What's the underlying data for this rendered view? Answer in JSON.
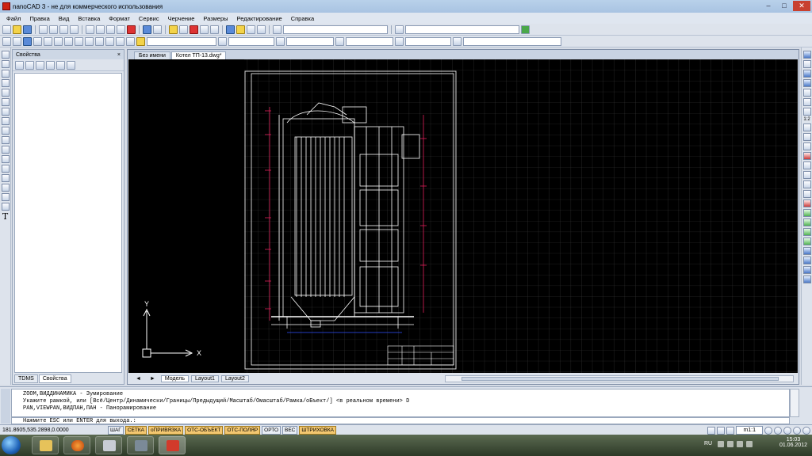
{
  "window": {
    "title": "nanoCAD 3 - не для коммерческого использования"
  },
  "menu": [
    "Файл",
    "Правка",
    "Вид",
    "Вставка",
    "Формат",
    "Сервис",
    "Черчение",
    "Размеры",
    "Редактирование",
    "Справка"
  ],
  "properties_panel": {
    "title": "Свойства",
    "close_glyph": "×",
    "tabs": [
      "TDMS",
      "Свойства"
    ]
  },
  "document_tabs": [
    "Без имени",
    "Котел ТП-13.dwg*"
  ],
  "layout_tabs": [
    "Модель",
    "Layout1",
    "Layout2"
  ],
  "layout_nav": [
    "◄",
    "►"
  ],
  "ucs": {
    "y_label": "Y",
    "x_label": "X"
  },
  "left_tools": {
    "text_tool_glyph": "T"
  },
  "right_tools": {
    "scale_label": "1:2"
  },
  "command": {
    "history": [
      "ZOOM,ВИДДИНАМИКА - Зумирование",
      "Укажите рамкой, или [Всё/Центр/Динамически/Границы/Предыдущий/Масштаб/Омасштаб/Рамка/оБъект/] <в реальном времени> D",
      "PAN,VIEWPAN,ВИДПАН,ПАН - Панорамирование"
    ],
    "prompt": "Нажмите  ESC или ENTER для выхода.:"
  },
  "status": {
    "coords": "181.8605,535.2898,0.0000",
    "buttons": [
      {
        "label": "ШАГ",
        "on": false
      },
      {
        "label": "СЕТКА",
        "on": true
      },
      {
        "label": "оПРИВЯЗКА",
        "on": true
      },
      {
        "label": "ОТС-ОБЪЕКТ",
        "on": true
      },
      {
        "label": "ОТС-ПОЛЯР",
        "on": true
      },
      {
        "label": "ОРТО",
        "on": false
      },
      {
        "label": "ВЕС",
        "on": false
      },
      {
        "label": "ШТРИХОВКА",
        "on": true
      }
    ],
    "scale": "m1:1"
  },
  "taskbar": {
    "lang": "RU",
    "time": "15:03",
    "date": "01.06.2012"
  },
  "colors": {
    "canvas": "#000000",
    "grid": "#3a3a3a",
    "drawing": "#ffffff",
    "dimension": "#e0205a",
    "status_on": "#f3c770"
  }
}
